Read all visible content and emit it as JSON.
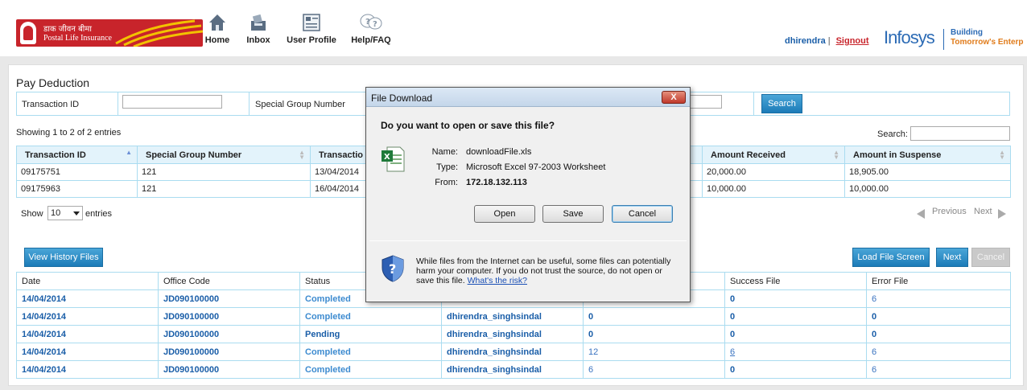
{
  "header": {
    "logo_hindi": "डाक जीवन बीमा",
    "logo_english": "Postal Life Insurance",
    "nav": [
      {
        "label": "Home",
        "icon": "home-icon"
      },
      {
        "label": "Inbox",
        "icon": "inbox-icon"
      },
      {
        "label": "User Profile",
        "icon": "user-profile-icon"
      },
      {
        "label": "Help/FAQ",
        "icon": "help-icon"
      }
    ],
    "username": "dhirendra",
    "separator": "|",
    "signout": "Signout",
    "brand": "Infosys",
    "tagline1": "Building",
    "tagline2": "Tomorrow's Enterp"
  },
  "page": {
    "title": "Pay Deduction",
    "filter": {
      "transaction_id_label": "Transaction ID",
      "special_group_label": "Special Group Number",
      "search_button": "Search"
    },
    "table_info": "Showing 1 to 2 of 2 entries",
    "search_label": "Search:",
    "columns": [
      "Transaction ID",
      "Special Group Number",
      "Transactio",
      "Amount Received",
      "Amount in Suspense"
    ],
    "rows": [
      {
        "txn": "09175751",
        "group": "121",
        "date": "13/04/2014",
        "received": "20,000.00",
        "suspense": "18,905.00"
      },
      {
        "txn": "09175963",
        "group": "121",
        "date": "16/04/2014",
        "received": "10,000.00",
        "suspense": "10,000.00"
      }
    ],
    "show_label": "Show",
    "page_size": "10",
    "entries_label": "entries",
    "previous": "Previous",
    "next_page": "Next",
    "buttons": {
      "view_history": "View History Files",
      "load_file_screen": "Load File Screen",
      "next": "Next",
      "cancel": "Cancel"
    },
    "files_columns": [
      "Date",
      "Office Code",
      "Status",
      "",
      "",
      "Success File",
      "Error File"
    ],
    "files_rows": [
      {
        "date": "14/04/2014",
        "office": "JD090100000",
        "status": "Completed",
        "user": "",
        "total": "",
        "success": "0",
        "error": "6"
      },
      {
        "date": "14/04/2014",
        "office": "JD090100000",
        "status": "Completed",
        "user": "dhirendra_singhsindal",
        "total": "0",
        "success": "0",
        "error": "0"
      },
      {
        "date": "14/04/2014",
        "office": "JD090100000",
        "status": "Pending",
        "user": "dhirendra_singhsindal",
        "total": "0",
        "success": "0",
        "error": "0"
      },
      {
        "date": "14/04/2014",
        "office": "JD090100000",
        "status": "Completed",
        "user": "dhirendra_singhsindal",
        "total": "12",
        "success": "6",
        "error": "6"
      },
      {
        "date": "14/04/2014",
        "office": "JD090100000",
        "status": "Completed",
        "user": "dhirendra_singhsindal",
        "total": "6",
        "success": "0",
        "error": "6"
      }
    ]
  },
  "dialog": {
    "title": "File Download",
    "close": "X",
    "question": "Do you want to open or save this file?",
    "name_label": "Name:",
    "name_value": "downloadFile.xls",
    "type_label": "Type:",
    "type_value": "Microsoft Excel 97-2003 Worksheet",
    "from_label": "From:",
    "from_value": "172.18.132.113",
    "open": "Open",
    "save": "Save",
    "cancel": "Cancel",
    "warning": "While files from the Internet can be useful, some files can potentially harm your computer. If you do not trust the source, do not open or save this file.",
    "risk_link": "What's the risk?"
  },
  "colors": {
    "brand_red": "#c8242b",
    "link_blue": "#1a5ea8",
    "accent_blue": "#1c7bb8",
    "table_border": "#aadcf0"
  }
}
